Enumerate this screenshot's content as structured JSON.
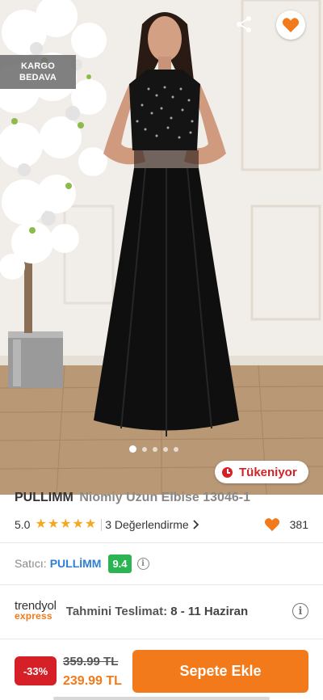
{
  "hero": {
    "kargo_line1": "KARGO",
    "kargo_line2": "BEDAVA",
    "image_count": 5,
    "active_index": 0,
    "stock_badge": "Tükeniyor"
  },
  "product": {
    "brand": "PULLIMM",
    "name": "Niomiy Uzun Elbise 13046-1",
    "rating": "5.0",
    "star_count": 5,
    "reviews": "3 Değerlendirme",
    "likes": "381"
  },
  "seller": {
    "label": "Satıcı:",
    "name": "PULLİMM",
    "score": "9.4"
  },
  "delivery": {
    "logo_top": "trendyol",
    "logo_bottom": "express",
    "label": "Tahmini Teslimat:",
    "value": "8 - 11 Haziran"
  },
  "pricing": {
    "discount": "-33%",
    "old_price": "359.99 TL",
    "new_price": "239.99 TL",
    "cart_button": "Sepete Ekle"
  },
  "colors": {
    "accent": "#f27a1a",
    "danger": "#d62027",
    "seller_blue": "#2d7fd3",
    "score_green": "#2ab552",
    "star": "#f5a623"
  }
}
